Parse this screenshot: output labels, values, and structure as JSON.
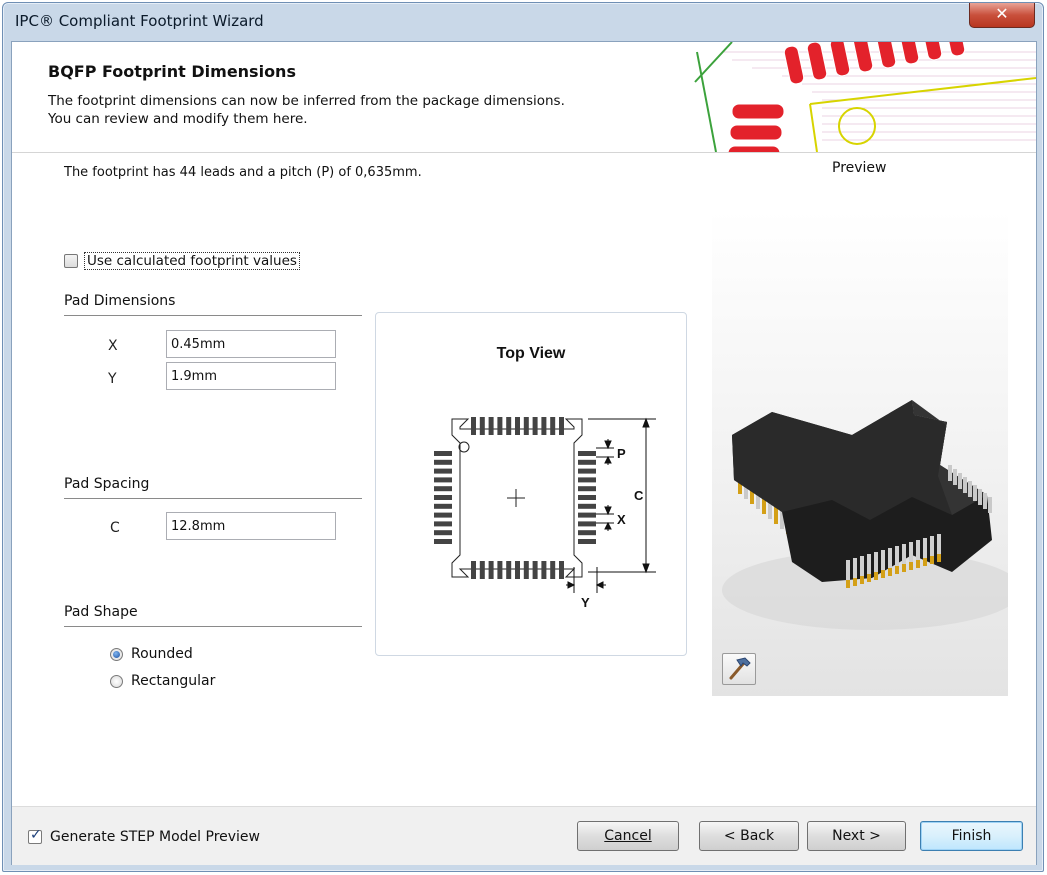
{
  "window": {
    "title": "IPC® Compliant Footprint Wizard",
    "close_glyph": "✕"
  },
  "header": {
    "title": "BQFP Footprint Dimensions",
    "desc_line1": "The footprint dimensions can now be inferred from the package dimensions.",
    "desc_line2": "You can review and modify them here."
  },
  "info": "The footprint has 44 leads and a pitch (P) of 0,635mm.",
  "use_calculated": {
    "label": "Use calculated footprint values",
    "checked": false
  },
  "pad_dimensions": {
    "section": "Pad Dimensions",
    "x_label": "X",
    "x_value": "0.45mm",
    "y_label": "Y",
    "y_value": "1.9mm"
  },
  "pad_spacing": {
    "section": "Pad Spacing",
    "c_label": "C",
    "c_value": "12.8mm"
  },
  "pad_shape": {
    "section": "Pad Shape",
    "options": [
      {
        "label": "Rounded",
        "selected": true
      },
      {
        "label": "Rectangular",
        "selected": false
      }
    ]
  },
  "diagram": {
    "title": "Top View",
    "labels": {
      "p": "P",
      "c": "C",
      "x": "X",
      "y": "Y"
    }
  },
  "preview": {
    "label": "Preview",
    "tool_icon": "hammer-icon"
  },
  "footer": {
    "generate_step": {
      "label": "Generate STEP Model Preview",
      "checked": true
    },
    "buttons": {
      "cancel": "Cancel",
      "back": "< Back",
      "next": "Next >",
      "finish": "Finish"
    }
  },
  "colors": {
    "pad_red": "#e3222b",
    "pcb_yellow": "#d7d400",
    "pcb_green": "#3ca23c",
    "pcb_magenta": "#c0207a",
    "pin_gold": "#d4a017",
    "chip_body": "#1c1c1c"
  }
}
